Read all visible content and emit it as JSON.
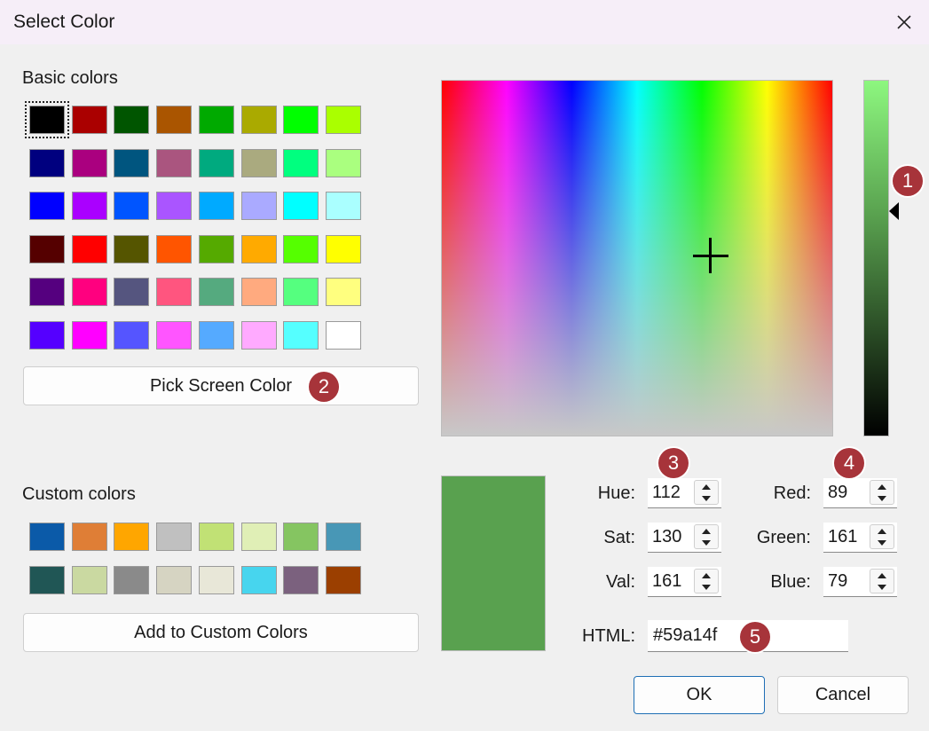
{
  "window": {
    "title": "Select Color"
  },
  "basic_colors": {
    "label": "Basic colors",
    "selected_index": 0,
    "swatches": [
      "#000000",
      "#aa0000",
      "#005500",
      "#aa5500",
      "#00aa00",
      "#aaaa00",
      "#00ff00",
      "#aaff00",
      "#00007f",
      "#aa007f",
      "#00557f",
      "#aa557f",
      "#00aa7f",
      "#aaaa7f",
      "#00ff7f",
      "#aaff7f",
      "#0000ff",
      "#aa00ff",
      "#0055ff",
      "#aa55ff",
      "#00aaff",
      "#aaaaff",
      "#00ffff",
      "#aaffff",
      "#550000",
      "#ff0000",
      "#555500",
      "#ff5500",
      "#55aa00",
      "#ffaa00",
      "#55ff00",
      "#ffff00",
      "#55007f",
      "#ff007f",
      "#55557f",
      "#ff557f",
      "#55aa7f",
      "#ffaa7f",
      "#55ff7f",
      "#ffff7f",
      "#5500ff",
      "#ff00ff",
      "#5555ff",
      "#ff55ff",
      "#55aaff",
      "#ffaaff",
      "#55ffff",
      "#ffffff"
    ]
  },
  "pick_screen_color": {
    "label": "Pick Screen Color"
  },
  "custom_colors": {
    "label": "Custom colors",
    "swatches": [
      "#0b5aa8",
      "#df7e36",
      "#ffa600",
      "#c0c0c0",
      "#c1e175",
      "#e0efb6",
      "#85c561",
      "#4897b6",
      "#205655",
      "#cad9a1",
      "#8a8a8a",
      "#d6d4c2",
      "#e8e7d8",
      "#47d5ee",
      "#7b617e",
      "#9b3f00"
    ]
  },
  "add_to_custom": {
    "label": "Add to Custom Colors"
  },
  "current_color": "#59a14f",
  "fields": {
    "hue": {
      "label": "Hue:",
      "value": "112"
    },
    "sat": {
      "label": "Sat:",
      "value": "130"
    },
    "val": {
      "label": "Val:",
      "value": "161"
    },
    "red": {
      "label": "Red:",
      "value": "89"
    },
    "green": {
      "label": "Green:",
      "value": "161"
    },
    "blue": {
      "label": "Blue:",
      "value": "79"
    },
    "html": {
      "label": "HTML:",
      "value": "#59a14f"
    }
  },
  "badges": {
    "b1": "1",
    "b2": "2",
    "b3": "3",
    "b4": "4",
    "b5": "5"
  },
  "buttons": {
    "ok": "OK",
    "cancel": "Cancel"
  },
  "icons": {
    "close": "close-icon"
  }
}
